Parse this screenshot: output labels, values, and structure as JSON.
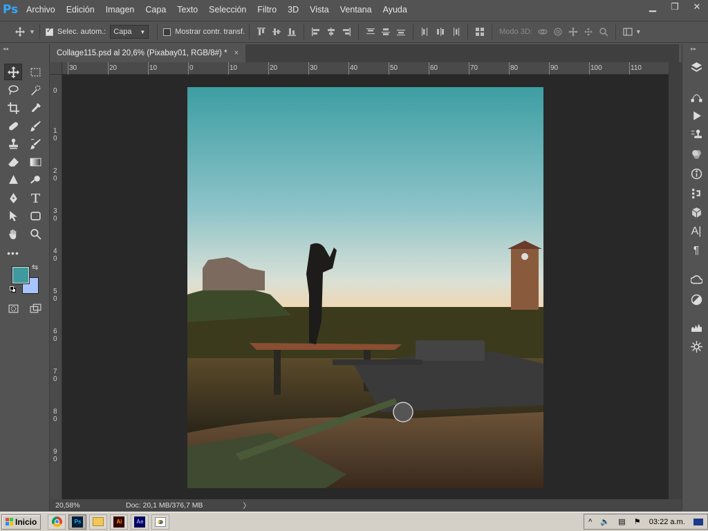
{
  "app": {
    "logo": "Ps",
    "accent": "#31a8ff"
  },
  "menu": [
    "Archivo",
    "Edición",
    "Imagen",
    "Capa",
    "Texto",
    "Selección",
    "Filtro",
    "3D",
    "Vista",
    "Ventana",
    "Ayuda"
  ],
  "window_controls": {
    "minimize": "minimize-icon",
    "restore": "restore-icon",
    "close": "close-icon"
  },
  "options": {
    "auto_select_label": "Selec. autom.:",
    "auto_select_checked": true,
    "layer_value": "Capa",
    "show_transform_label": "Mostrar contr. transf.",
    "show_transform_checked": false,
    "mode3d_label": "Modo 3D:"
  },
  "document": {
    "tab_title": "Collage115.psd al 20,6% (Pixabay01, RGB/8#) *",
    "close": "×"
  },
  "ruler_h": [
    "30",
    "20",
    "10",
    "0",
    "10",
    "20",
    "30",
    "40",
    "50",
    "60",
    "70",
    "80",
    "90",
    "100",
    "110"
  ],
  "ruler_v": [
    "0",
    "1 0",
    "2 0",
    "3 0",
    "4 0",
    "5 0",
    "6 0",
    "7 0",
    "8 0",
    "9 0"
  ],
  "status": {
    "zoom": "20,58%",
    "doc": "Doc: 20,1 MB/376,7 MB",
    "arrow": "〉"
  },
  "colors": {
    "foreground": "#3f9aa0",
    "background": "#a8c4ff"
  },
  "taskbar": {
    "start_label": "Inicio",
    "clock": "03:22 a.m.",
    "apps": [
      "chrome-icon",
      "photoshop-icon",
      "file-explorer-icon",
      "illustrator-icon",
      "after-effects-icon",
      "paint-icon"
    ]
  }
}
